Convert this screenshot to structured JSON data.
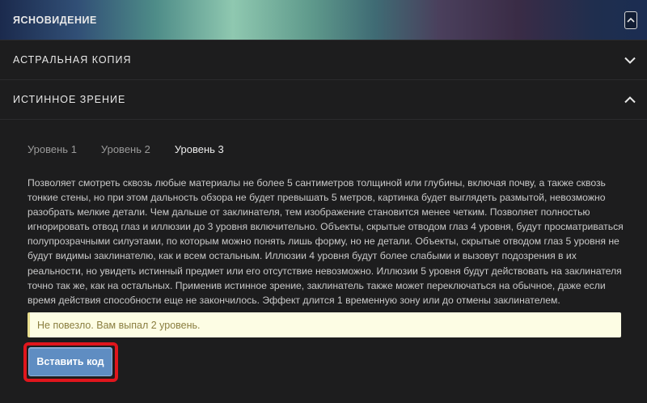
{
  "accordion": {
    "items": [
      {
        "label": "Ясновидение",
        "state": "open",
        "icon": "chevron-up-icon"
      },
      {
        "label": "Астральная копия",
        "state": "closed",
        "icon": "chevron-down-icon"
      },
      {
        "label": "Истинное зрение",
        "state": "open",
        "icon": "chevron-up-icon"
      }
    ]
  },
  "tabs": [
    {
      "label": "Уровень 1",
      "active": false
    },
    {
      "label": "Уровень 2",
      "active": false
    },
    {
      "label": "Уровень 3",
      "active": true
    }
  ],
  "description": "Позволяет смотреть сквозь любые материалы не более 5 сантиметров толщиной или глубины, включая почву, а также сквозь тонкие стены, но при этом дальность обзора не будет превышать 5 метров, картинка будет выглядеть размытой, невозможно разобрать мелкие детали. Чем дальше от заклинателя, тем изображение становится менее четким. Позволяет полностью игнорировать отвод глаз и иллюзии до 3 уровня включительно. Объекты, скрытые отводом глаз 4 уровня, будут просматриваться полупрозрачными силуэтами, по которым можно понять лишь форму, но не детали. Объекты, скрытые отводом глаз 5 уровня не будут видимы заклинателю, как и всем остальным. Иллюзии 4 уровня будут более слабыми и вызовут подозрения в их реальности, но увидеть истинный предмет или его отсутствие невозможно. Иллюзии 5 уровня будут действовать на заклинателя точно так же, как на остальных. Применив истинное зрение, заклинатель также может переключаться на обычное, даже если время действия способности еще не закончилось. Эффект длится 1 временную зону или до отмены заклинателем.",
  "alert": {
    "text": "Не повезло. Вам выпал 2 уровень."
  },
  "insert_button": {
    "label": "Вставить код"
  },
  "colors": {
    "button": "#5f8dc2",
    "highlight": "#e0161d",
    "alert_bg": "#fdfde4"
  }
}
